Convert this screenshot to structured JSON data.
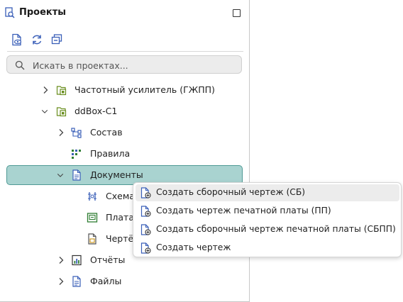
{
  "panel": {
    "title": "Проекты",
    "search": {
      "placeholder": "Искать в проектах..."
    }
  },
  "tree": {
    "items": [
      {
        "label": "Частотный усилитель (ГЖПП)",
        "icon": "project-icon",
        "chevron": "right"
      },
      {
        "label": "ddBox-C1",
        "icon": "project-icon",
        "chevron": "down"
      },
      {
        "label": "Состав",
        "icon": "hierarchy-icon",
        "chevron": "right"
      },
      {
        "label": "Правила",
        "icon": "rules-icon",
        "chevron": ""
      },
      {
        "label": "Документы",
        "icon": "documents-icon",
        "chevron": "down",
        "selected": true
      },
      {
        "label": "Схема",
        "icon": "schematic-icon",
        "chevron": ""
      },
      {
        "label": "Плата",
        "icon": "pcb-icon",
        "chevron": ""
      },
      {
        "label": "Чертёж",
        "icon": "drawing-icon",
        "chevron": ""
      },
      {
        "label": "Отчёты",
        "icon": "reports-icon",
        "chevron": "right"
      },
      {
        "label": "Файлы",
        "icon": "file-icon",
        "chevron": "right"
      }
    ]
  },
  "context_menu": {
    "items": [
      {
        "label": "Создать сборочный чертеж (СБ)",
        "highlighted": true
      },
      {
        "label": "Создать чертеж печатной платы (ПП)"
      },
      {
        "label": "Создать сборочный чертеж печатной платы (СБПП)"
      },
      {
        "label": "Создать чертеж"
      }
    ]
  },
  "colors": {
    "accent": "#3a5fb8",
    "selection_fill": "#a9d3d0",
    "selection_border": "#4f9a95",
    "project_icon": "#6a8e1f"
  }
}
